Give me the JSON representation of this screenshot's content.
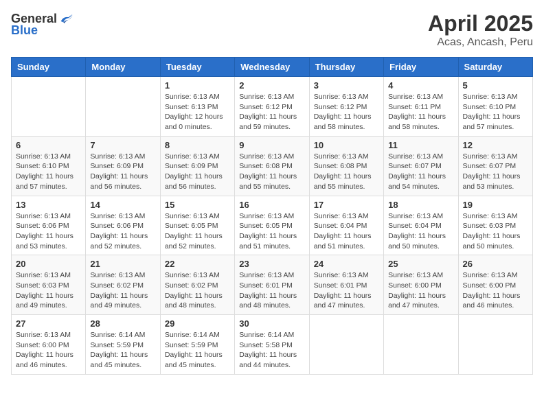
{
  "header": {
    "logo_general": "General",
    "logo_blue": "Blue",
    "title": "April 2025",
    "subtitle": "Acas, Ancash, Peru"
  },
  "days_of_week": [
    "Sunday",
    "Monday",
    "Tuesday",
    "Wednesday",
    "Thursday",
    "Friday",
    "Saturday"
  ],
  "weeks": [
    [
      {
        "day": "",
        "info": ""
      },
      {
        "day": "",
        "info": ""
      },
      {
        "day": "1",
        "info": "Sunrise: 6:13 AM\nSunset: 6:13 PM\nDaylight: 12 hours\nand 0 minutes."
      },
      {
        "day": "2",
        "info": "Sunrise: 6:13 AM\nSunset: 6:12 PM\nDaylight: 11 hours\nand 59 minutes."
      },
      {
        "day": "3",
        "info": "Sunrise: 6:13 AM\nSunset: 6:12 PM\nDaylight: 11 hours\nand 58 minutes."
      },
      {
        "day": "4",
        "info": "Sunrise: 6:13 AM\nSunset: 6:11 PM\nDaylight: 11 hours\nand 58 minutes."
      },
      {
        "day": "5",
        "info": "Sunrise: 6:13 AM\nSunset: 6:10 PM\nDaylight: 11 hours\nand 57 minutes."
      }
    ],
    [
      {
        "day": "6",
        "info": "Sunrise: 6:13 AM\nSunset: 6:10 PM\nDaylight: 11 hours\nand 57 minutes."
      },
      {
        "day": "7",
        "info": "Sunrise: 6:13 AM\nSunset: 6:09 PM\nDaylight: 11 hours\nand 56 minutes."
      },
      {
        "day": "8",
        "info": "Sunrise: 6:13 AM\nSunset: 6:09 PM\nDaylight: 11 hours\nand 56 minutes."
      },
      {
        "day": "9",
        "info": "Sunrise: 6:13 AM\nSunset: 6:08 PM\nDaylight: 11 hours\nand 55 minutes."
      },
      {
        "day": "10",
        "info": "Sunrise: 6:13 AM\nSunset: 6:08 PM\nDaylight: 11 hours\nand 55 minutes."
      },
      {
        "day": "11",
        "info": "Sunrise: 6:13 AM\nSunset: 6:07 PM\nDaylight: 11 hours\nand 54 minutes."
      },
      {
        "day": "12",
        "info": "Sunrise: 6:13 AM\nSunset: 6:07 PM\nDaylight: 11 hours\nand 53 minutes."
      }
    ],
    [
      {
        "day": "13",
        "info": "Sunrise: 6:13 AM\nSunset: 6:06 PM\nDaylight: 11 hours\nand 53 minutes."
      },
      {
        "day": "14",
        "info": "Sunrise: 6:13 AM\nSunset: 6:06 PM\nDaylight: 11 hours\nand 52 minutes."
      },
      {
        "day": "15",
        "info": "Sunrise: 6:13 AM\nSunset: 6:05 PM\nDaylight: 11 hours\nand 52 minutes."
      },
      {
        "day": "16",
        "info": "Sunrise: 6:13 AM\nSunset: 6:05 PM\nDaylight: 11 hours\nand 51 minutes."
      },
      {
        "day": "17",
        "info": "Sunrise: 6:13 AM\nSunset: 6:04 PM\nDaylight: 11 hours\nand 51 minutes."
      },
      {
        "day": "18",
        "info": "Sunrise: 6:13 AM\nSunset: 6:04 PM\nDaylight: 11 hours\nand 50 minutes."
      },
      {
        "day": "19",
        "info": "Sunrise: 6:13 AM\nSunset: 6:03 PM\nDaylight: 11 hours\nand 50 minutes."
      }
    ],
    [
      {
        "day": "20",
        "info": "Sunrise: 6:13 AM\nSunset: 6:03 PM\nDaylight: 11 hours\nand 49 minutes."
      },
      {
        "day": "21",
        "info": "Sunrise: 6:13 AM\nSunset: 6:02 PM\nDaylight: 11 hours\nand 49 minutes."
      },
      {
        "day": "22",
        "info": "Sunrise: 6:13 AM\nSunset: 6:02 PM\nDaylight: 11 hours\nand 48 minutes."
      },
      {
        "day": "23",
        "info": "Sunrise: 6:13 AM\nSunset: 6:01 PM\nDaylight: 11 hours\nand 48 minutes."
      },
      {
        "day": "24",
        "info": "Sunrise: 6:13 AM\nSunset: 6:01 PM\nDaylight: 11 hours\nand 47 minutes."
      },
      {
        "day": "25",
        "info": "Sunrise: 6:13 AM\nSunset: 6:00 PM\nDaylight: 11 hours\nand 47 minutes."
      },
      {
        "day": "26",
        "info": "Sunrise: 6:13 AM\nSunset: 6:00 PM\nDaylight: 11 hours\nand 46 minutes."
      }
    ],
    [
      {
        "day": "27",
        "info": "Sunrise: 6:13 AM\nSunset: 6:00 PM\nDaylight: 11 hours\nand 46 minutes."
      },
      {
        "day": "28",
        "info": "Sunrise: 6:14 AM\nSunset: 5:59 PM\nDaylight: 11 hours\nand 45 minutes."
      },
      {
        "day": "29",
        "info": "Sunrise: 6:14 AM\nSunset: 5:59 PM\nDaylight: 11 hours\nand 45 minutes."
      },
      {
        "day": "30",
        "info": "Sunrise: 6:14 AM\nSunset: 5:58 PM\nDaylight: 11 hours\nand 44 minutes."
      },
      {
        "day": "",
        "info": ""
      },
      {
        "day": "",
        "info": ""
      },
      {
        "day": "",
        "info": ""
      }
    ]
  ]
}
